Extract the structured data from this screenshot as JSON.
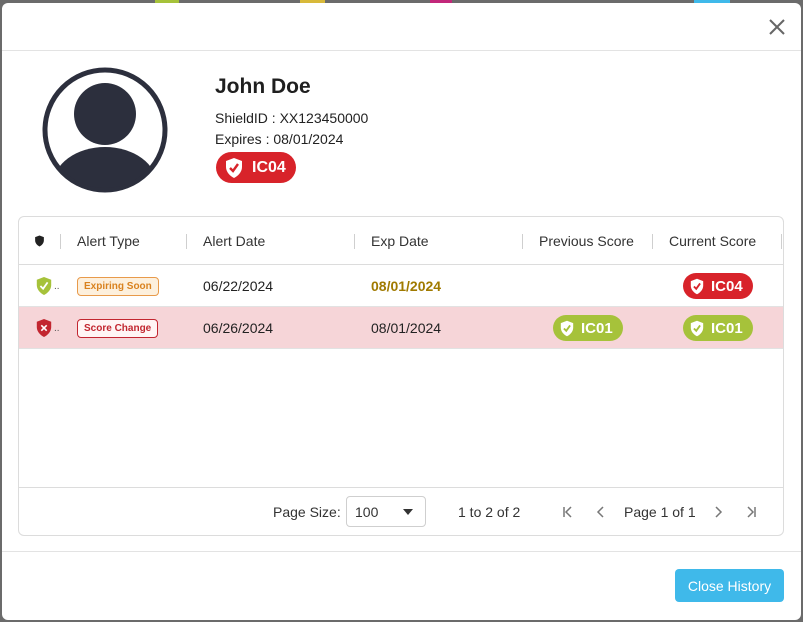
{
  "colors": {
    "red": "#d8232a",
    "green": "#a6c23a",
    "gold": "#a07a00",
    "accent": "#3fb9ea",
    "pink_row": "#f6d5d8"
  },
  "profile": {
    "name": "John Doe",
    "shield_id": "ShieldID : XX123450000",
    "expires": "Expires : 08/01/2024",
    "badge": "IC04"
  },
  "grid": {
    "headers": [
      "Alert Type",
      "Alert Date",
      "Exp Date",
      "Previous Score",
      "Current Score"
    ],
    "rows": [
      {
        "icon": "shield-check-icon",
        "alert_type": "Expiring Soon",
        "alert_date": "06/22/2024",
        "exp_date": "08/01/2024",
        "previous_score": "",
        "current_score": "IC04"
      },
      {
        "icon": "shield-x-icon",
        "alert_type": "Score Change",
        "alert_date": "06/26/2024",
        "exp_date": "08/01/2024",
        "previous_score": "IC01",
        "current_score": "IC01"
      }
    ]
  },
  "pager": {
    "page_size_label": "Page Size:",
    "page_size_value": "100",
    "range": "1 to 2 of 2",
    "page_info": "Page 1 of 1"
  },
  "footer": {
    "close_label": "Close History"
  }
}
